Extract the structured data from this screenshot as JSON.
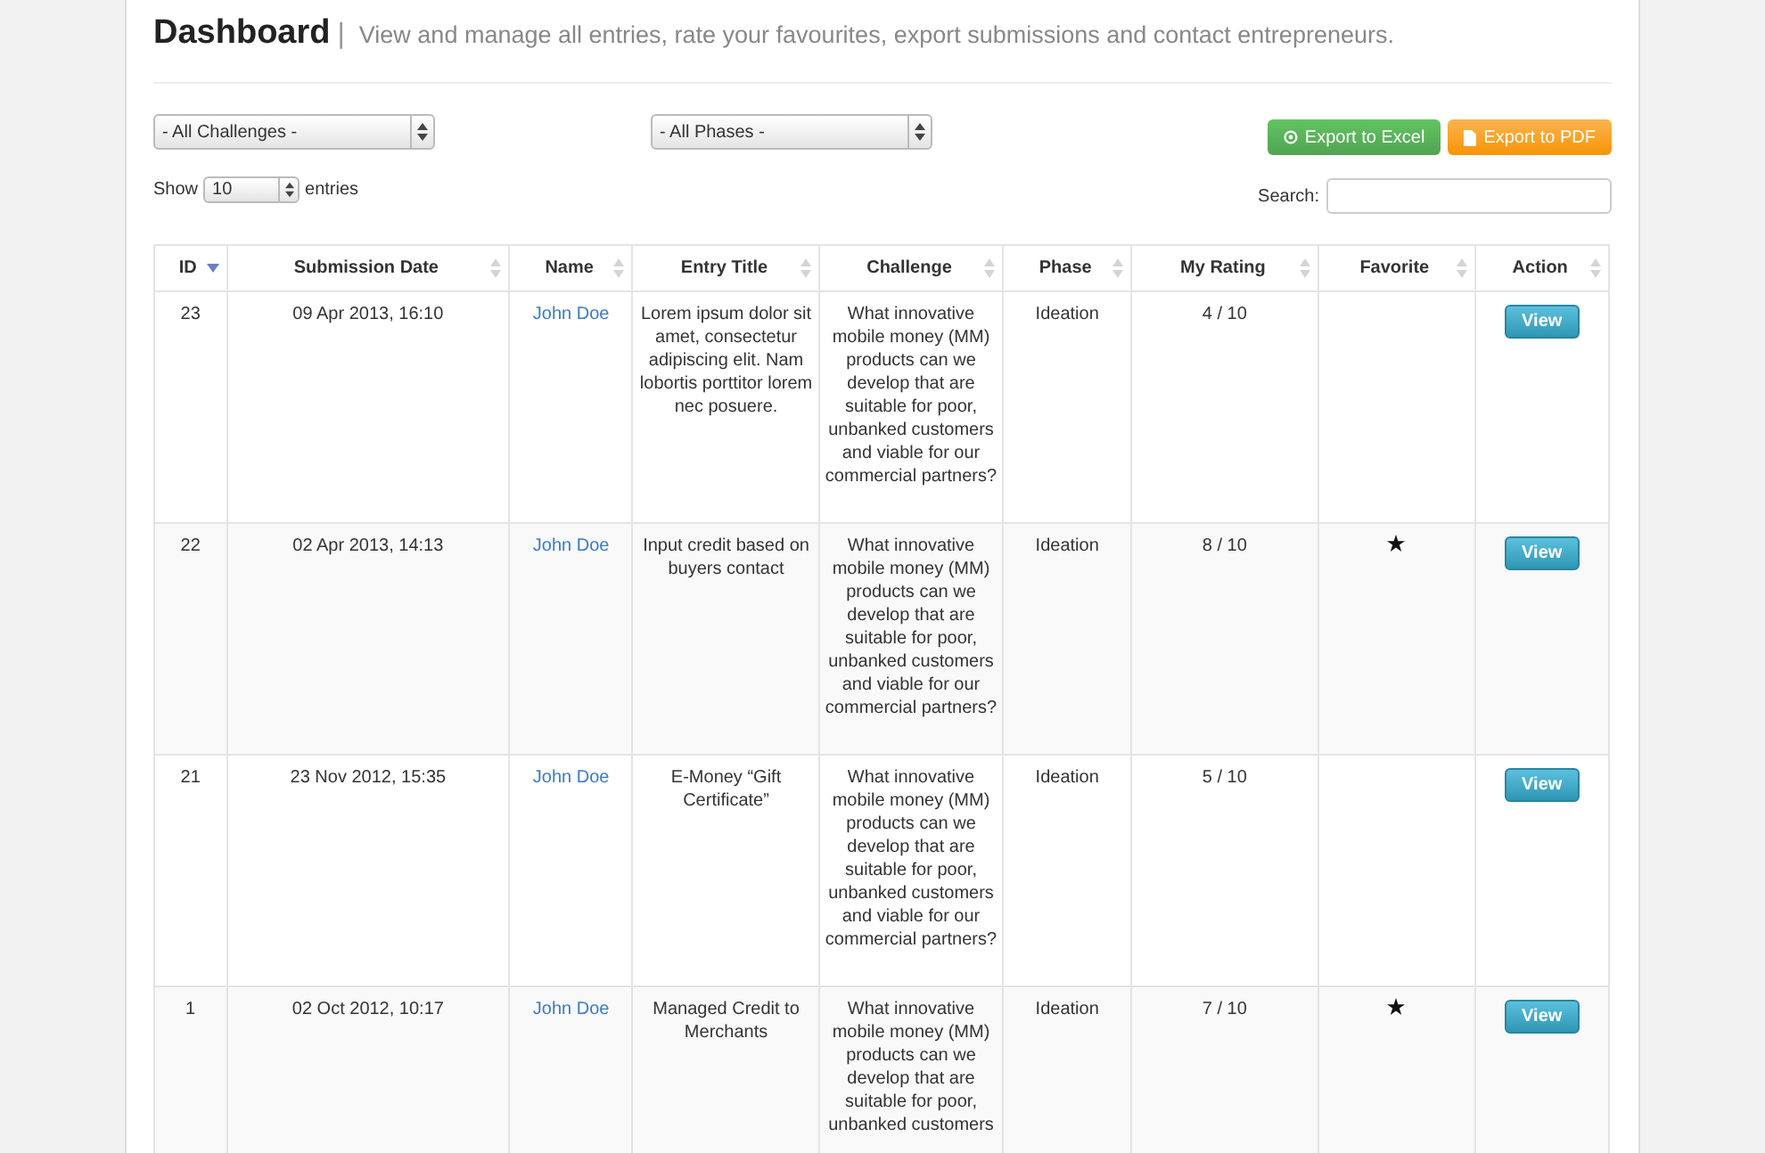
{
  "header": {
    "title": "Dashboard",
    "separator": "|",
    "subtitle": "View and manage all entries, rate your favourites, export submissions and contact entrepreneurs."
  },
  "filters": {
    "challenge_select": "- All Challenges -",
    "phase_select": "- All Phases -"
  },
  "export_buttons": [
    {
      "kind": "excel",
      "label": "Export to Excel"
    },
    {
      "kind": "pdf",
      "label": "Export to PDF"
    }
  ],
  "length_control": {
    "before": "Show",
    "value": "10",
    "after": "entries"
  },
  "search": {
    "label": "Search:"
  },
  "table": {
    "columns": [
      {
        "label": "ID",
        "sorted": true
      },
      {
        "label": "Submission Date",
        "sorted": false
      },
      {
        "label": "Name",
        "sorted": false
      },
      {
        "label": "Entry Title",
        "sorted": false
      },
      {
        "label": "Challenge",
        "sorted": false
      },
      {
        "label": "Phase",
        "sorted": false
      },
      {
        "label": "My Rating",
        "sorted": false
      },
      {
        "label": "Favorite",
        "sorted": false
      },
      {
        "label": "Action",
        "sorted": false
      }
    ],
    "rows": [
      {
        "id": "23",
        "date": "09 Apr 2013, 16:10",
        "name": "John Doe",
        "title": "Lorem ipsum dolor sit amet, consectetur adipiscing elit. Nam lobortis porttitor lorem nec posuere.",
        "challenge": "What innovative mobile money (MM) products can we develop that are suitable for poor, unbanked customers and viable for our commercial partners?",
        "phase": "Ideation",
        "rating": "4 / 10",
        "favorite": false,
        "action": "View"
      },
      {
        "id": "22",
        "date": "02 Apr 2013, 14:13",
        "name": "John Doe",
        "title": "Input credit based on buyers contact",
        "challenge": "What innovative mobile money (MM) products can we develop that are suitable for poor, unbanked customers and viable for our commercial partners?",
        "phase": "Ideation",
        "rating": "8 / 10",
        "favorite": true,
        "action": "View"
      },
      {
        "id": "21",
        "date": "23 Nov 2012, 15:35",
        "name": "John Doe",
        "title": "E-Money “Gift Certificate”",
        "challenge": "What innovative mobile money (MM) products can we develop that are suitable for poor, unbanked customers and viable for our commercial partners?",
        "phase": "Ideation",
        "rating": "5 / 10",
        "favorite": false,
        "action": "View"
      },
      {
        "id": "1",
        "date": "02 Oct 2012, 10:17",
        "name": "John Doe",
        "title": "Managed Credit to Merchants",
        "challenge": "What innovative mobile money (MM) products can we develop that are suitable for poor, unbanked customers",
        "phase": "Ideation",
        "rating": "7 / 10",
        "favorite": true,
        "action": "View"
      }
    ]
  }
}
